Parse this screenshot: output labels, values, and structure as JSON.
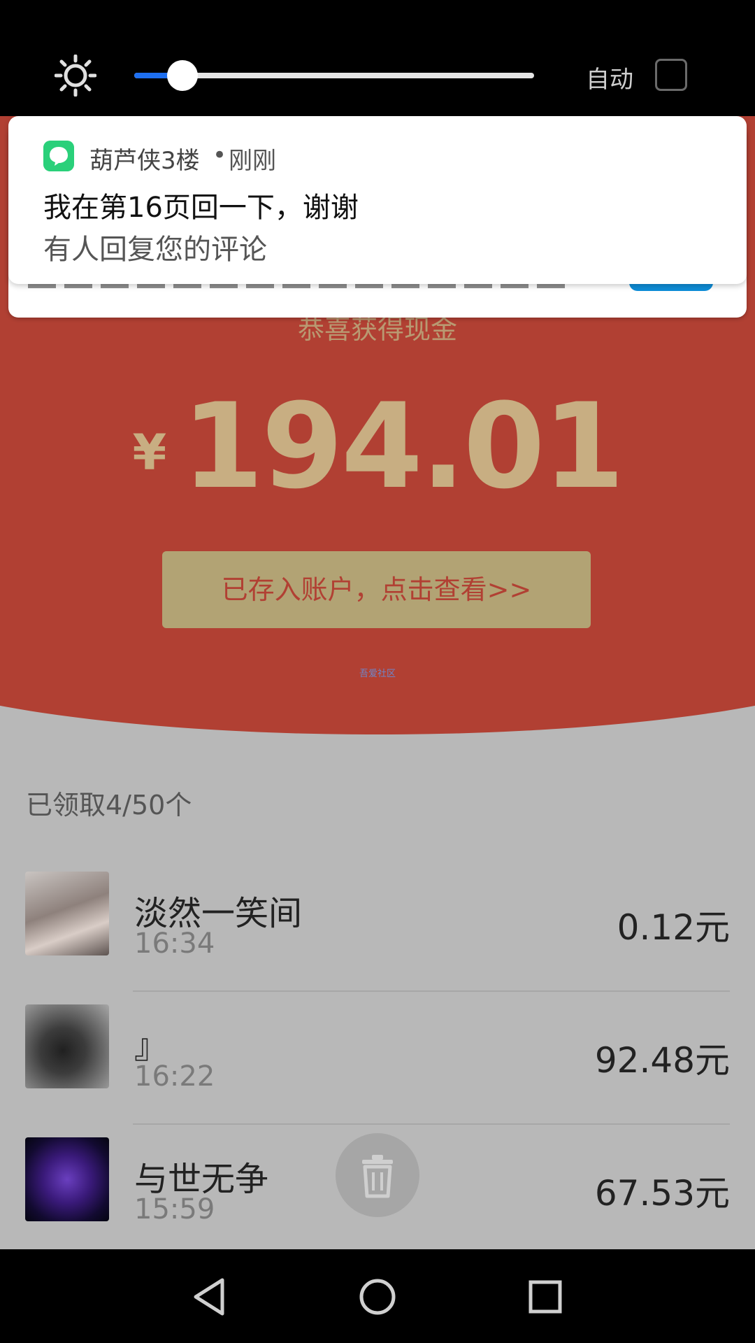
{
  "top_bar": {
    "brightness_icon": "sun-icon",
    "brightness_level": 0.12,
    "auto_label": "自动",
    "auto_checked": false
  },
  "notification": {
    "app_icon": "chat-bubble-icon",
    "app_name": "葫芦侠3楼",
    "dot": "•",
    "time": "刚刚",
    "title": "我在第16页回一下，谢谢",
    "body": "有人回复您的评论"
  },
  "header": {
    "congrats": "恭喜获得现金",
    "currency": "¥",
    "amount": "194.01",
    "check_button": "已存入账户，点击查看>>",
    "watermark": "吾爱社区"
  },
  "list": {
    "claimed": "已领取4/50个",
    "items": [
      {
        "name": "淡然一笑间",
        "time": "16:34",
        "amount": "0.12元"
      },
      {
        "name": "』",
        "time": "16:22",
        "amount": "92.48元"
      },
      {
        "name": "与世无争",
        "time": "15:59",
        "amount": "67.53元"
      }
    ]
  },
  "overlay": {
    "trash_icon": "trash-icon"
  },
  "nav": {
    "back": "back-triangle-icon",
    "home": "home-circle-icon",
    "recents": "recents-square-icon"
  },
  "colors": {
    "red": "#b14033",
    "gold": "#c8ae82",
    "button": "#b2a374",
    "accent": "#1e6ff0"
  }
}
